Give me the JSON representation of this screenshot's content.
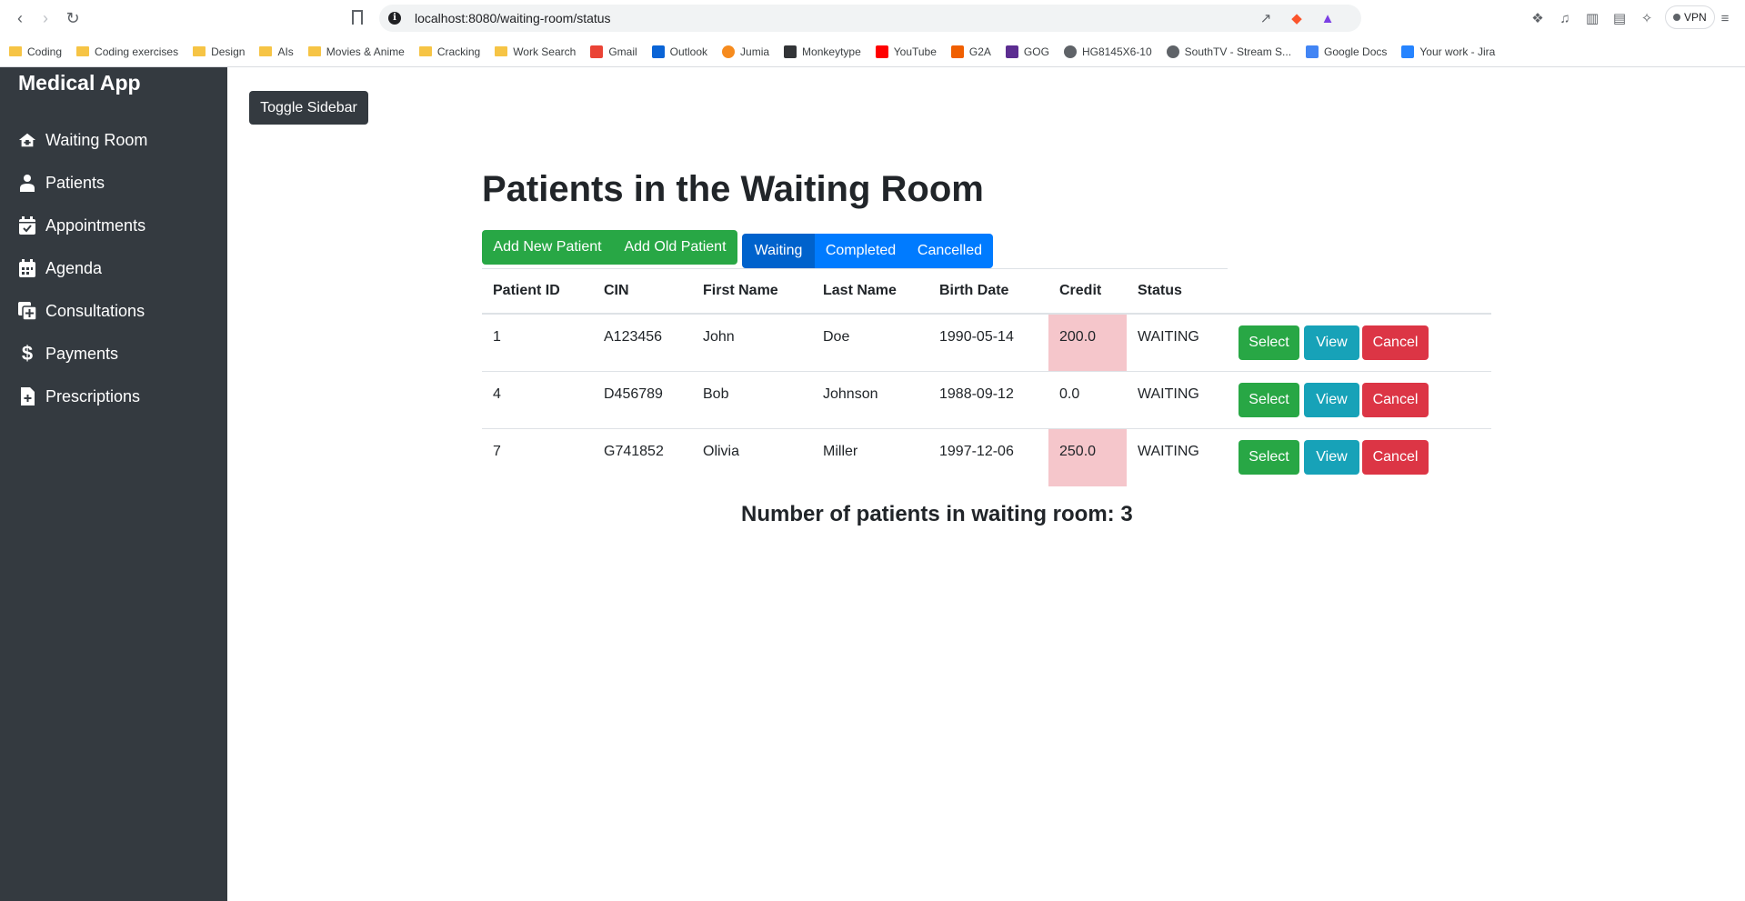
{
  "browser": {
    "url": "localhost:8080/waiting-room/status",
    "vpn_label": "VPN",
    "bookmarks": [
      {
        "label": "Coding",
        "icon": "folder-icon"
      },
      {
        "label": "Coding exercises",
        "icon": "folder-icon"
      },
      {
        "label": "Design",
        "icon": "folder-icon"
      },
      {
        "label": "AIs",
        "icon": "folder-icon"
      },
      {
        "label": "Movies & Anime",
        "icon": "folder-icon"
      },
      {
        "label": "Cracking",
        "icon": "folder-icon"
      },
      {
        "label": "Work Search",
        "icon": "folder-icon"
      },
      {
        "label": "Gmail",
        "icon": "gmail-icon"
      },
      {
        "label": "Outlook",
        "icon": "outlook-icon"
      },
      {
        "label": "Jumia",
        "icon": "jumia-icon"
      },
      {
        "label": "Monkeytype",
        "icon": "monkeytype-icon"
      },
      {
        "label": "YouTube",
        "icon": "youtube-icon"
      },
      {
        "label": "G2A",
        "icon": "g2a-icon"
      },
      {
        "label": "GOG",
        "icon": "gog-icon"
      },
      {
        "label": "HG8145X6-10",
        "icon": "globe-icon"
      },
      {
        "label": "SouthTV - Stream S...",
        "icon": "globe-icon"
      },
      {
        "label": "Google Docs",
        "icon": "google-docs-icon"
      },
      {
        "label": "Your work - Jira",
        "icon": "jira-icon"
      }
    ]
  },
  "sidebar": {
    "brand": "Medical App",
    "items": [
      {
        "label": "Waiting Room",
        "icon": "clinic-house-icon"
      },
      {
        "label": "Patients",
        "icon": "user-doctor-icon"
      },
      {
        "label": "Appointments",
        "icon": "calendar-check-icon"
      },
      {
        "label": "Agenda",
        "icon": "calendar-grid-icon"
      },
      {
        "label": "Consultations",
        "icon": "notes-medical-icon"
      },
      {
        "label": "Payments",
        "icon": "dollar-icon"
      },
      {
        "label": "Prescriptions",
        "icon": "file-medical-icon"
      }
    ]
  },
  "main": {
    "toggle_label": "Toggle Sidebar",
    "title": "Patients in the Waiting Room",
    "add_new_label": "Add New Patient",
    "add_old_label": "Add Old Patient",
    "filters": {
      "waiting": "Waiting",
      "completed": "Completed",
      "cancelled": "Cancelled",
      "active": "Waiting"
    },
    "columns": [
      "Patient ID",
      "CIN",
      "First Name",
      "Last Name",
      "Birth Date",
      "Credit",
      "Status"
    ],
    "rows": [
      {
        "id": "1",
        "cin": "A123456",
        "first": "John",
        "last": "Doe",
        "birth": "1990-05-14",
        "credit": "200.0",
        "status": "WAITING",
        "credit_highlight": true
      },
      {
        "id": "4",
        "cin": "D456789",
        "first": "Bob",
        "last": "Johnson",
        "birth": "1988-09-12",
        "credit": "0.0",
        "status": "WAITING",
        "credit_highlight": false
      },
      {
        "id": "7",
        "cin": "G741852",
        "first": "Olivia",
        "last": "Miller",
        "birth": "1997-12-06",
        "credit": "250.0",
        "status": "WAITING",
        "credit_highlight": true
      }
    ],
    "row_actions": {
      "select": "Select",
      "view": "View",
      "cancel": "Cancel"
    },
    "summary": "Number of patients in waiting room: 3"
  },
  "colors": {
    "sidebar": "#343a40",
    "success": "#28a745",
    "primary": "#007bff",
    "info": "#17a2b8",
    "danger": "#dc3545",
    "credit_highlight": "#f5c6cb"
  }
}
